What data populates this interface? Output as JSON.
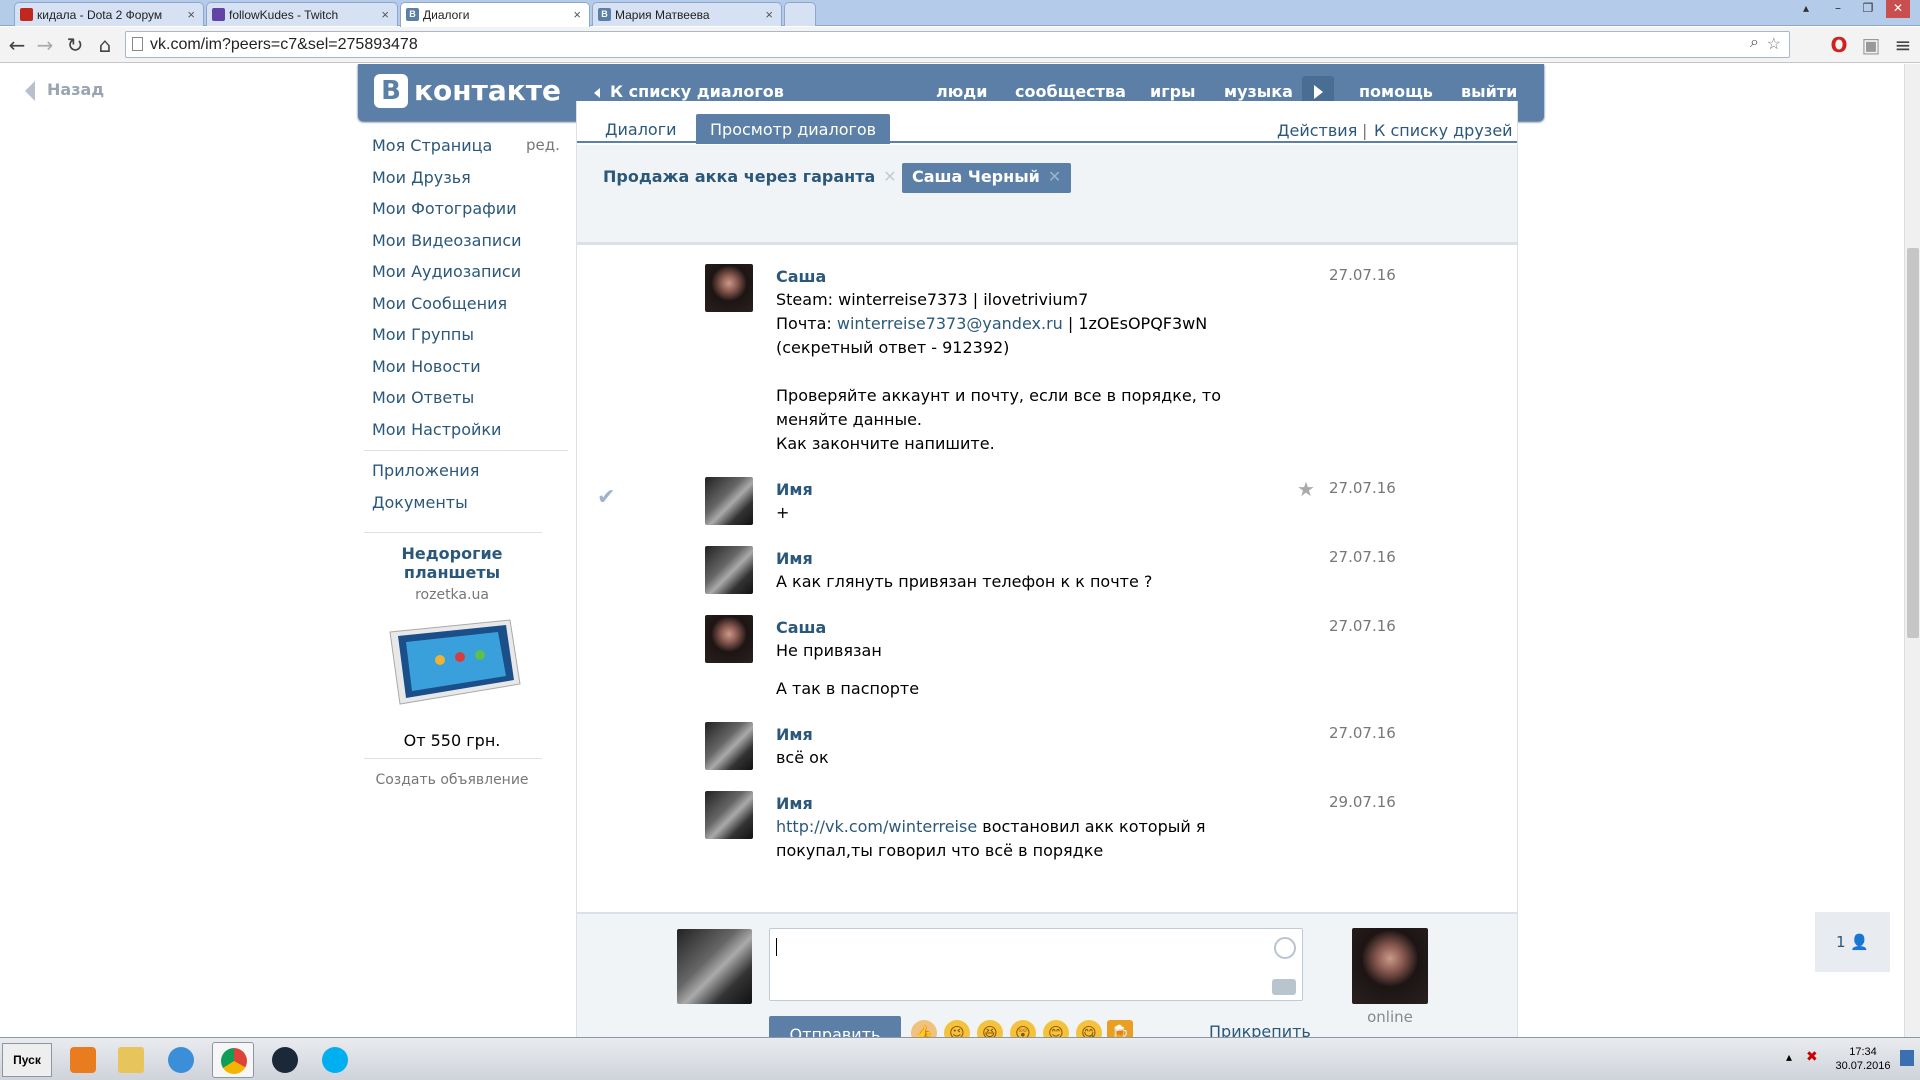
{
  "browser": {
    "tabs": [
      {
        "label": "кидала - Dota 2 Форум",
        "favicon_color": "#c0281e"
      },
      {
        "label": "followKudes - Twitch",
        "favicon_color": "#6441a5"
      },
      {
        "label": "Диалоги",
        "favicon_color": "#5b7fa6"
      },
      {
        "label": "Мария Матвеева",
        "favicon_color": "#5b7fa6"
      }
    ],
    "url": "vk.com/im?peers=c7&sel=275893478"
  },
  "page": {
    "back_label": "Назад",
    "logo_text": "контакте",
    "logo_letter": "В",
    "back_to_dialogs": "К списку диалогов",
    "top_nav": [
      "люди",
      "сообщества",
      "игры",
      "музыка",
      "помощь",
      "выйти"
    ],
    "left_menu": [
      "Моя Страница",
      "Мои Друзья",
      "Мои Фотографии",
      "Мои Видеозаписи",
      "Мои Аудиозаписи",
      "Мои Сообщения",
      "Мои Группы",
      "Мои Новости",
      "Мои Ответы",
      "Мои Настройки"
    ],
    "left_menu_extra": [
      "Приложения",
      "Документы"
    ],
    "edit_label": "ред.",
    "ad": {
      "title": "Недорогие планшеты",
      "site": "rozetka.ua",
      "price": "От 550 грн.",
      "create": "Создать объявление"
    },
    "tabs": [
      "Диалоги",
      "Просмотр диалогов"
    ],
    "right_links": [
      "Действия",
      "|",
      "К списку друзей"
    ],
    "peers": [
      "Продажа акка через гаранта",
      "Саша Черный"
    ],
    "messages": [
      {
        "author": "Саша",
        "date": "27.07.16",
        "lines": [
          "Steam: winterreise7373 | ilovetrivium7"
        ],
        "line2_prefix": "Почта: ",
        "line2_link": "winterreise7373@yandex.ru",
        "line2_suffix": " | 1zOEsOPQF3wN (секретный ответ - 912392)",
        "line3": "Проверяйте аккаунт и почту, если все в порядке, то меняйте данные.",
        "line4": "Как закончите напишите."
      },
      {
        "author": "Имя",
        "date": "27.07.16",
        "text": "+"
      },
      {
        "author": "Имя",
        "date": "27.07.16",
        "text": "А как глянуть привязан телефон к к почте ?"
      },
      {
        "author": "Саша",
        "date": "27.07.16",
        "text": "Не привязан",
        "text2": "А так в паспорте"
      },
      {
        "author": "Имя",
        "date": "27.07.16",
        "text": "всё ок"
      },
      {
        "author": "Имя",
        "date": "29.07.16",
        "link": "http://vk.com/winterreise",
        "text": " востановил акк который я покупал,ты говорил что всё в порядке"
      }
    ],
    "compose": {
      "send": "Отправить",
      "attach": "Прикрепить",
      "status": "online",
      "friends_online": "1"
    }
  },
  "taskbar": {
    "start": "Пуск",
    "time": "17:34",
    "date": "30.07.2016"
  }
}
